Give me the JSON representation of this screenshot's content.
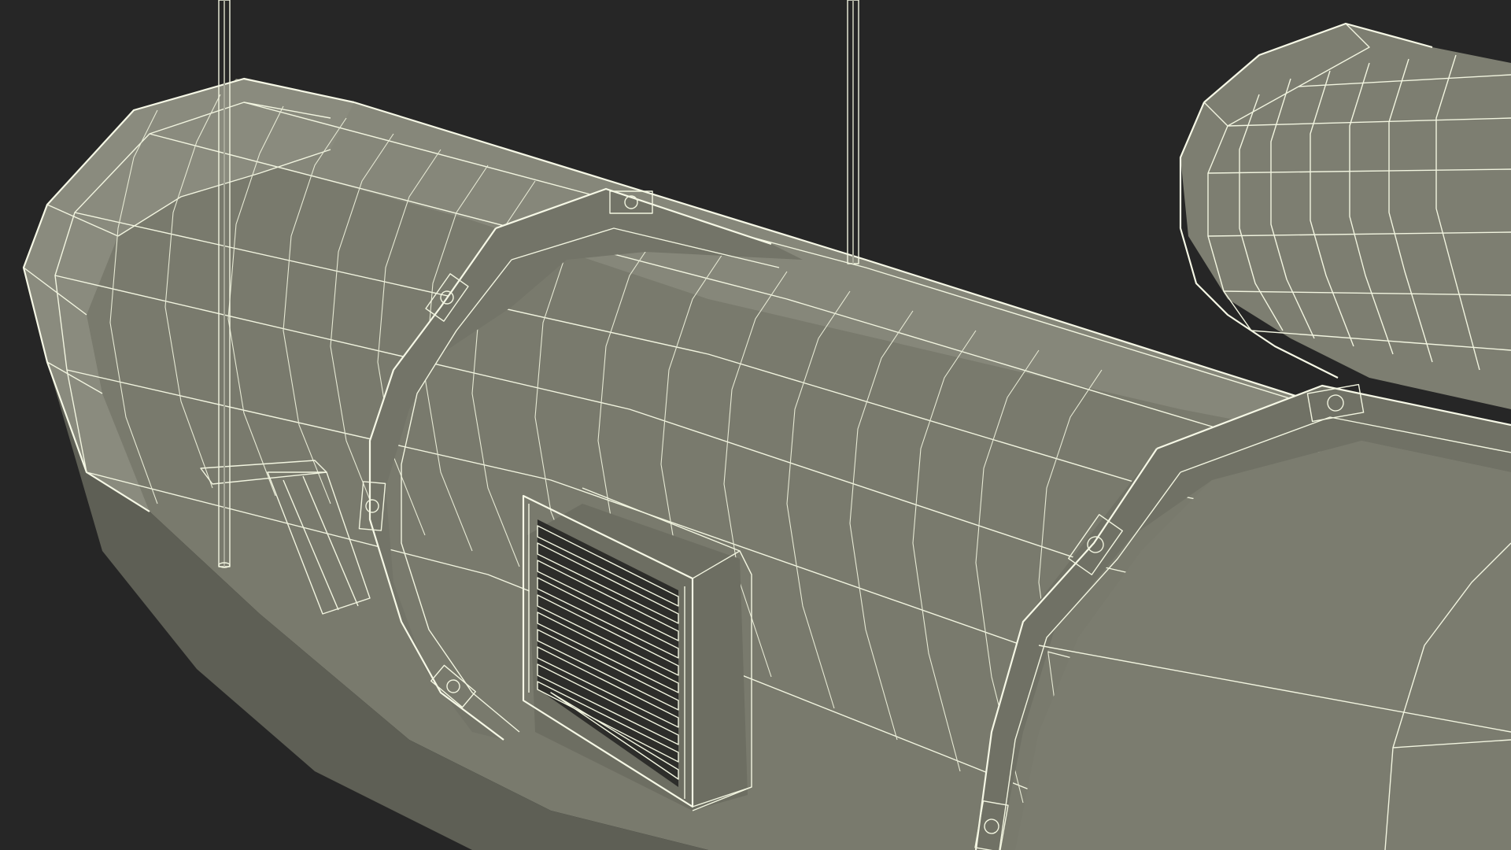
{
  "scene": {
    "subject_icon": "hvac-duct-wireframe-icon",
    "colors": {
      "background": "#262626",
      "duct_fill": "#7a7b6e",
      "duct_fill_dark": "#5f6056",
      "duct_fill_light": "#8a8b7e",
      "wire": "#f2f5e0"
    }
  }
}
